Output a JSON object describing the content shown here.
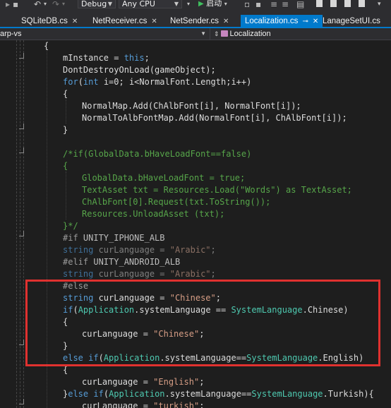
{
  "toolbar": {
    "configuration": "Debug",
    "platform": "Any CPU",
    "start_label": "启动"
  },
  "tabs": [
    {
      "label": "SQLiteDB.cs"
    },
    {
      "label": "NetReceiver.cs"
    },
    {
      "label": "NetSender.cs"
    },
    {
      "label": "Localization.cs",
      "active": true
    },
    {
      "label": "LanageSetUI.cs"
    }
  ],
  "navbar": {
    "project": "arp-vs",
    "member": "Localization"
  },
  "code_lines": [
    "{",
    "mInstance = this;",
    "DontDestroyOnLoad(gameObject);",
    "for(int i=0; i<NormalFont.Length;i++)",
    "{",
    "NormalMap.Add(ChAlbFont[i], NormalFont[i]);",
    "NormalToAlbFontMap.Add(NormalFont[i], ChAlbFont[i]);",
    "}",
    "",
    "/*if(GlobalData.bHaveLoadFont==false)",
    "{",
    "GlobalData.bHaveLoadFont = true;",
    "TextAsset txt = Resources.Load(\"Words\") as TextAsset;",
    "ChAlbFont[0].Request(txt.ToString());",
    "Resources.UnloadAsset (txt);",
    "}*/",
    "#if UNITY_IPHONE_ALB",
    "string curLanguage = \"Arabic\";",
    "#elif UNITY_ANDROID_ALB",
    "string curLanguage = \"Arabic\";",
    "#else",
    "string curLanguage = \"Chinese\";",
    "if(Application.systemLanguage == SystemLanguage.Chinese)",
    "{",
    "curLanguage = \"Chinese\";",
    "}",
    "else if(Application.systemLanguage==SystemLanguage.English)",
    "{",
    "curLanguage = \"English\";",
    "}else if(Application.systemLanguage==SystemLanguage.Turkish){",
    "curLanguage = \"turkish\";"
  ],
  "colors": {
    "editor_bg": "#1e1e1e",
    "keyword": "#569cd6",
    "type": "#4ec9b0",
    "string": "#d69d85",
    "comment": "#57a64a",
    "preprocessor": "#9b9b9b",
    "active_tab": "#007acc",
    "highlight_box": "#e0312f"
  },
  "icons": [
    "undo-icon",
    "redo-icon",
    "play-icon",
    "pin-icon",
    "close-icon",
    "class-icon",
    "dropdown-caret-icon"
  ]
}
